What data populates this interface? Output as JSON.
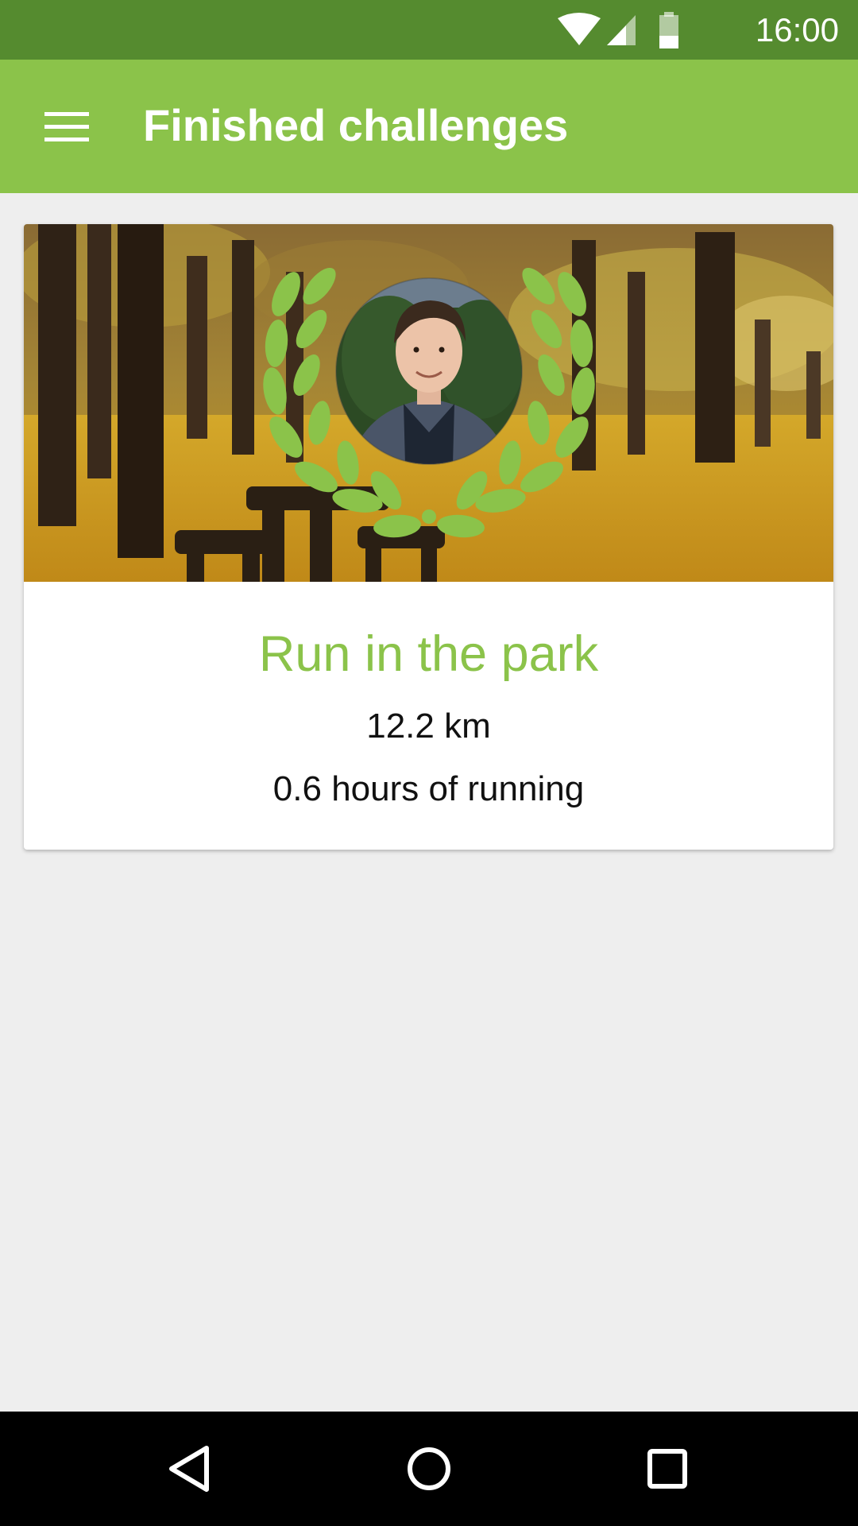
{
  "status_bar": {
    "time": "16:00",
    "icons": [
      "wifi-icon",
      "cell-signal-icon",
      "battery-icon"
    ]
  },
  "app_bar": {
    "title": "Finished challenges",
    "menu_icon": "hamburger-menu-icon"
  },
  "challenge_card": {
    "title": "Run in the park",
    "distance": "12.2 km",
    "duration": "0.6 hours of running"
  },
  "nav_bar": {
    "icons": [
      "back-icon",
      "home-icon",
      "recents-icon"
    ]
  },
  "colors": {
    "status_bar": "#558b2f",
    "app_bar": "#8bc34a",
    "accent": "#8bc34a",
    "laurel": "#8bc34a",
    "background": "#eeeeee"
  }
}
